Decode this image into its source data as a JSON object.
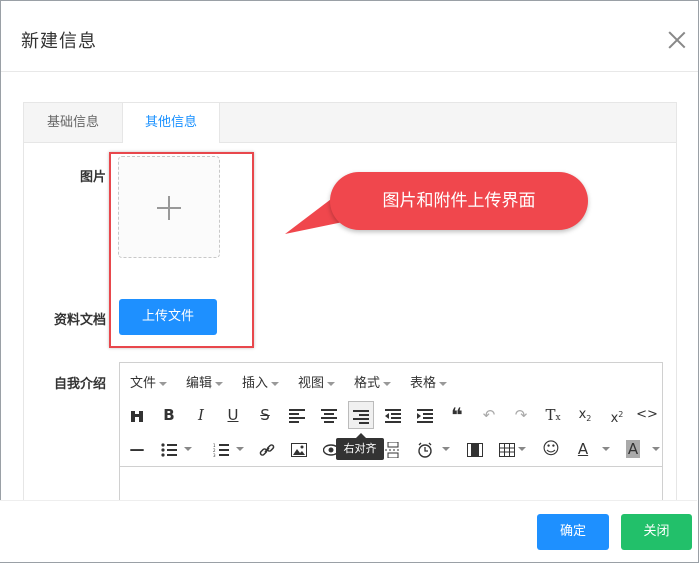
{
  "modal": {
    "title": "新建信息"
  },
  "tabs": [
    {
      "label": "基础信息"
    },
    {
      "label": "其他信息"
    }
  ],
  "form": {
    "image_label": "图片",
    "doc_label": "资料文档",
    "intro_label": "自我介绍",
    "upload_button": "上传文件"
  },
  "callout": {
    "text": "图片和附件上传界面"
  },
  "editor": {
    "menus": [
      "文件",
      "编辑",
      "插入",
      "视图",
      "格式",
      "表格"
    ],
    "tooltip": "右对齐"
  },
  "footer": {
    "ok_label": "确定",
    "close_label": "关闭"
  },
  "colors": {
    "primary": "#1e90ff",
    "success": "#22c06a",
    "annotation": "#f0474d"
  }
}
